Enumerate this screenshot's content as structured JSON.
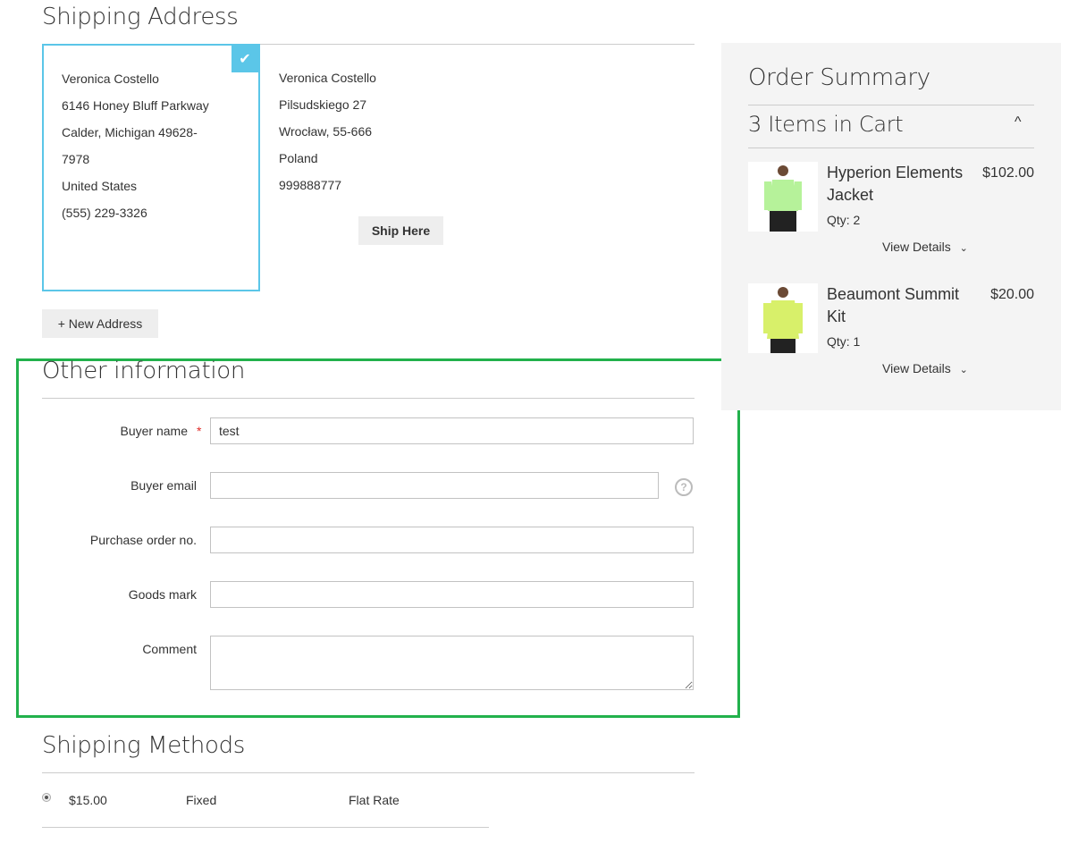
{
  "shipping_address": {
    "title": "Shipping Address",
    "selected_address": {
      "lines": [
        "Veronica Costello",
        "6146 Honey Bluff Parkway",
        "Calder, Michigan 49628-",
        "7978",
        "United States",
        "(555) 229-3326"
      ],
      "check_icon": "✔"
    },
    "other_address": {
      "lines": [
        "Veronica Costello",
        "Pilsudskiego 27",
        "Wrocław, 55-666",
        "Poland",
        "999888777"
      ],
      "ship_here_label": "Ship Here"
    },
    "new_address_label": "+ New Address"
  },
  "other_information": {
    "title": "Other information",
    "fields": [
      {
        "label": "Buyer name",
        "required": true,
        "required_mark": "*",
        "value": "test"
      },
      {
        "label": "Buyer email",
        "value": "",
        "help_icon": "?"
      },
      {
        "label": "Purchase order no.",
        "value": ""
      },
      {
        "label": "Goods mark",
        "value": ""
      },
      {
        "label": "Comment",
        "value": ""
      }
    ]
  },
  "shipping_methods": {
    "title": "Shipping Methods",
    "methods": [
      {
        "price": "$15.00",
        "method": "Fixed",
        "carrier": "Flat Rate",
        "selected": true
      }
    ]
  },
  "order_summary": {
    "title": "Order Summary",
    "items_in_cart": "3 Items in Cart",
    "collapse_icon": "^",
    "items": [
      {
        "name": "Hyperion Elements Jacket",
        "price": "$102.00",
        "qty": "Qty: 2",
        "view_details": "View Details",
        "color": "#b6f29a"
      },
      {
        "name": "Beaumont Summit Kit",
        "price": "$20.00",
        "qty": "Qty: 1",
        "view_details": "View Details",
        "color": "#d8f06a"
      }
    ]
  },
  "colors": {
    "accent": "#5bc6e8",
    "highlight_box": "#22b14c",
    "required": "#e02b27"
  }
}
